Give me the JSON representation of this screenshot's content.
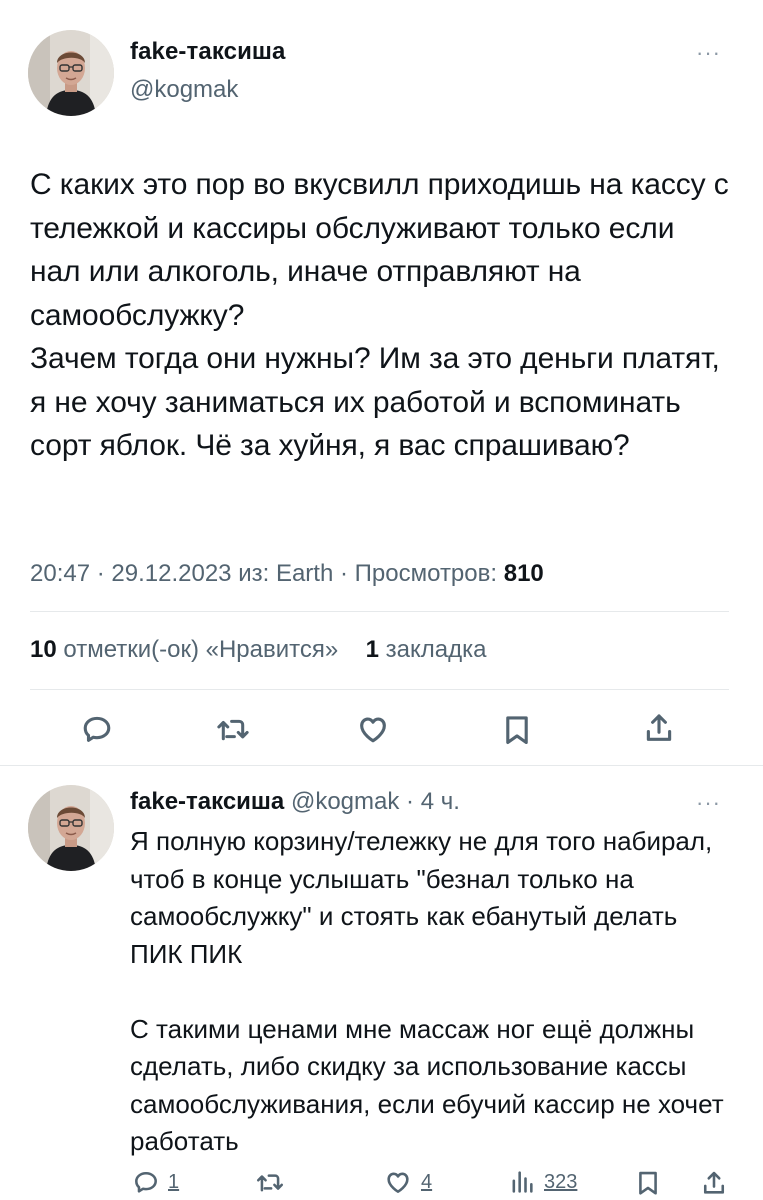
{
  "tweet": {
    "author_name": "fake-таксиша",
    "author_handle": "@kogmak",
    "more_label": "···",
    "text": "С каких это пор во вкусвилл приходишь на кассу с тележкой и кассиры обслуживают только если нал или алкоголь, иначе отправляют на самообслужку?\nЗачем тогда они нужны? Им за это деньги платят, я не хочу заниматься их работой и вспоминать сорт яблок. Чё за хуйня, я вас спрашиваю?",
    "time": "20:47",
    "date": "29.12.2023",
    "source_prefix": "из:",
    "source": "Earth",
    "views_label": "Просмотров:",
    "views_count": "810",
    "likes_count": "10",
    "likes_label": "отметки(-ок) «Нравится»",
    "bookmarks_count": "1",
    "bookmarks_label": "закладка",
    "actions": [
      "reply-icon",
      "retweet-icon",
      "like-icon",
      "bookmark-icon",
      "share-icon"
    ]
  },
  "reply": {
    "author_name": "fake-таксиша",
    "author_handle": "@kogmak",
    "dot": "·",
    "time": "4 ч.",
    "more_label": "···",
    "text": "Я полную корзину/тележку не для того набирал, чтоб в конце услышать \"безнал только на самообслужку\" и стоять как ебанутый делать ПИК ПИК\n\nС такими ценами мне массаж ног ещё должны сделать, либо скидку за использование кассы самообслуживания, если ебучий кассир не хочет работать",
    "reply_count": "1",
    "like_count": "4",
    "views_count": "323"
  },
  "colors": {
    "text": "#0f1419",
    "secondary": "#536471",
    "divider": "#e6e9eb"
  }
}
